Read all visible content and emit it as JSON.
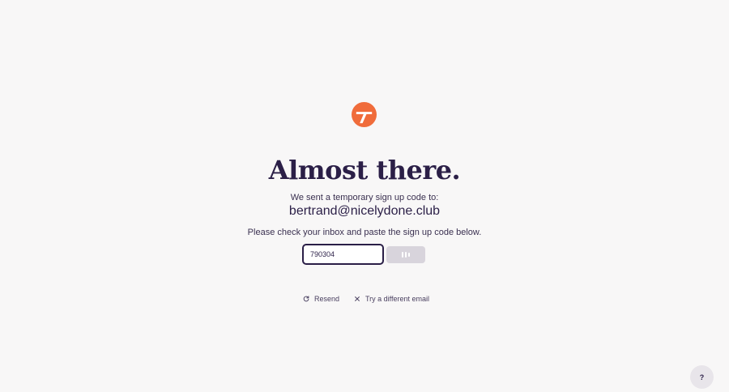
{
  "brand": {
    "logo_icon": "brand-t-logo-icon",
    "accent_color": "#f06c3b"
  },
  "headline": "Almost there.",
  "sent_message": "We sent a temporary sign up code to:",
  "email": "bertrand@nicelydone.club",
  "instructions": "Please check your inbox and paste the sign up code below.",
  "code_input": {
    "value": "790304",
    "placeholder": ""
  },
  "submit_button": {
    "icon": "loading-icon",
    "state": "loading"
  },
  "links": {
    "resend": {
      "label": "Resend",
      "icon": "refresh-icon"
    },
    "different_email": {
      "label": "Try a different email",
      "icon": "close-icon"
    }
  },
  "help_button": {
    "label": "?"
  }
}
